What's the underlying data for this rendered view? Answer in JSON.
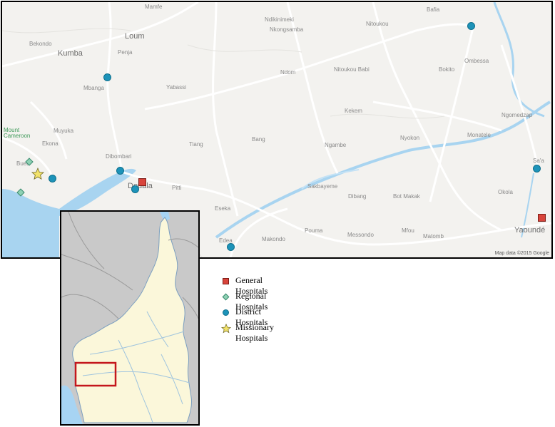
{
  "map": {
    "places": [
      {
        "name": "Mamfe",
        "kind": "minor"
      },
      {
        "name": "Bekondo",
        "kind": "minor"
      },
      {
        "name": "Kumba",
        "kind": "major"
      },
      {
        "name": "Loum",
        "kind": "major"
      },
      {
        "name": "Penja",
        "kind": "minor"
      },
      {
        "name": "Mbanga",
        "kind": "minor"
      },
      {
        "name": "Yabassi",
        "kind": "minor"
      },
      {
        "name": "Nkongsamba",
        "kind": "minor"
      },
      {
        "name": "Bafia",
        "kind": "minor"
      },
      {
        "name": "Nitoukou",
        "kind": "minor"
      },
      {
        "name": "Bokito",
        "kind": "minor"
      },
      {
        "name": "Ombessa",
        "kind": "minor"
      },
      {
        "name": "Monatele",
        "kind": "minor"
      },
      {
        "name": "Ngomedzap",
        "kind": "minor"
      },
      {
        "name": "Sa'a",
        "kind": "minor"
      },
      {
        "name": "Ndikinimeki",
        "kind": "minor"
      },
      {
        "name": "Nitoukou Babi",
        "kind": "minor"
      },
      {
        "name": "Ndom",
        "kind": "minor"
      },
      {
        "name": "Kekem",
        "kind": "minor"
      },
      {
        "name": "Nyokon",
        "kind": "minor"
      },
      {
        "name": "Ngambe",
        "kind": "minor"
      },
      {
        "name": "Bang",
        "kind": "minor"
      },
      {
        "name": "Tiang",
        "kind": "minor"
      },
      {
        "name": "Mount Cameroon",
        "kind": "park"
      },
      {
        "name": "Muyuka",
        "kind": "minor"
      },
      {
        "name": "Ekona",
        "kind": "minor"
      },
      {
        "name": "Buea",
        "kind": "minor"
      },
      {
        "name": "Dibombari",
        "kind": "minor"
      },
      {
        "name": "Douala",
        "kind": "major"
      },
      {
        "name": "Pitti",
        "kind": "minor"
      },
      {
        "name": "Edea",
        "kind": "minor"
      },
      {
        "name": "Sakbayeme",
        "kind": "minor"
      },
      {
        "name": "Dibang",
        "kind": "minor"
      },
      {
        "name": "Bot Makak",
        "kind": "minor"
      },
      {
        "name": "Eseka",
        "kind": "minor"
      },
      {
        "name": "Makondo",
        "kind": "minor"
      },
      {
        "name": "Pouma",
        "kind": "minor"
      },
      {
        "name": "Messondo",
        "kind": "minor"
      },
      {
        "name": "Matomb",
        "kind": "minor"
      },
      {
        "name": "Mfou",
        "kind": "minor"
      },
      {
        "name": "Okola",
        "kind": "minor"
      },
      {
        "name": "Yaoundé",
        "kind": "major"
      }
    ],
    "attribution": "Map data ©2015 Google",
    "colors": {
      "land": "#f3f2ef",
      "water": "#a8d4f0",
      "road": "#ffffff"
    }
  },
  "markers": [
    {
      "type": "district",
      "name": "district-hospital-bafia"
    },
    {
      "type": "district",
      "name": "district-hospital-mbanga"
    },
    {
      "type": "district",
      "name": "district-hospital-dibombari"
    },
    {
      "type": "district",
      "name": "district-hospital-douala"
    },
    {
      "type": "district",
      "name": "district-hospital-tiko"
    },
    {
      "type": "district",
      "name": "district-hospital-edea"
    },
    {
      "type": "district",
      "name": "district-hospital-sa-a"
    },
    {
      "type": "general",
      "name": "general-hospital-douala"
    },
    {
      "type": "general",
      "name": "general-hospital-yaounde"
    },
    {
      "type": "regional",
      "name": "regional-hospital-buea"
    },
    {
      "type": "regional",
      "name": "regional-hospital-limbe"
    },
    {
      "type": "missionary",
      "name": "missionary-hospital-mutengene"
    }
  ],
  "legend": [
    {
      "type": "general",
      "label": "General Hospitals",
      "color": "#d8443b"
    },
    {
      "type": "regional",
      "label": "Regional  Hospitals",
      "color": "#8fd1b4"
    },
    {
      "type": "district",
      "label": "District Hospitals",
      "color": "#1d93b9"
    },
    {
      "type": "missionary",
      "label": "Missionary Hospitals",
      "color": "#f2e26a"
    }
  ],
  "inset": {
    "colors": {
      "country": "#fbf7da",
      "neighbours": "#c9c9c9",
      "sea": "#a7d4f3",
      "highlight": "#c4161c"
    }
  }
}
